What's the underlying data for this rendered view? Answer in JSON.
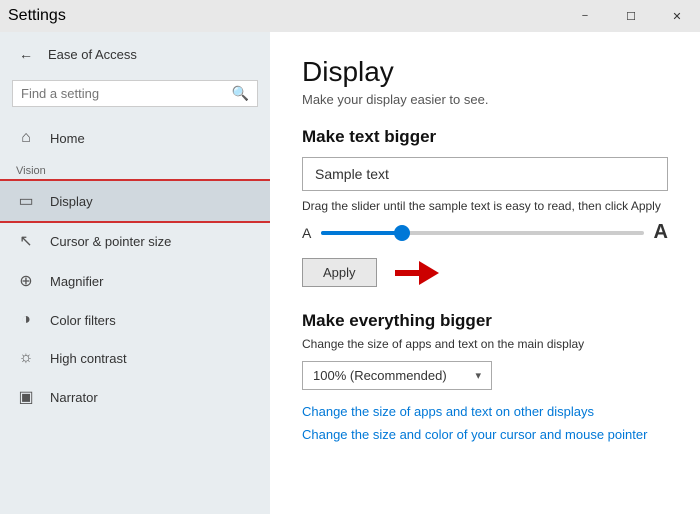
{
  "titlebar": {
    "title": "Settings",
    "min_label": "−",
    "max_label": "☐",
    "close_label": "✕"
  },
  "sidebar": {
    "back_arrow": "←",
    "nav_title": "Settings",
    "search_placeholder": "Find a setting",
    "section_label": "Ease of Access",
    "vision_label": "Vision",
    "items": [
      {
        "id": "home",
        "label": "Home",
        "icon": "⌂"
      },
      {
        "id": "display",
        "label": "Display",
        "icon": "▭",
        "active": true
      },
      {
        "id": "cursor",
        "label": "Cursor & pointer size",
        "icon": "↖"
      },
      {
        "id": "magnifier",
        "label": "Magnifier",
        "icon": "⊕"
      },
      {
        "id": "color-filters",
        "label": "Color filters",
        "icon": "◑"
      },
      {
        "id": "high-contrast",
        "label": "High contrast",
        "icon": "☼"
      },
      {
        "id": "narrator",
        "label": "Narrator",
        "icon": "▣"
      }
    ]
  },
  "content": {
    "title": "Display",
    "subtitle": "Make your display easier to see.",
    "make_text_bigger": {
      "section_title": "Make text bigger",
      "sample_text": "Sample text",
      "slider_desc": "Drag the slider until the sample text is easy to read, then click Apply",
      "small_a": "A",
      "big_a": "A",
      "apply_label": "Apply",
      "slider_value": 25
    },
    "make_everything_bigger": {
      "section_title": "Make everything bigger",
      "desc": "Change the size of apps and text on the main display",
      "dropdown_value": "100% (Recommended)",
      "link1": "Change the size of apps and text on other displays",
      "link2": "Change the size and color of your cursor and mouse pointer"
    }
  }
}
